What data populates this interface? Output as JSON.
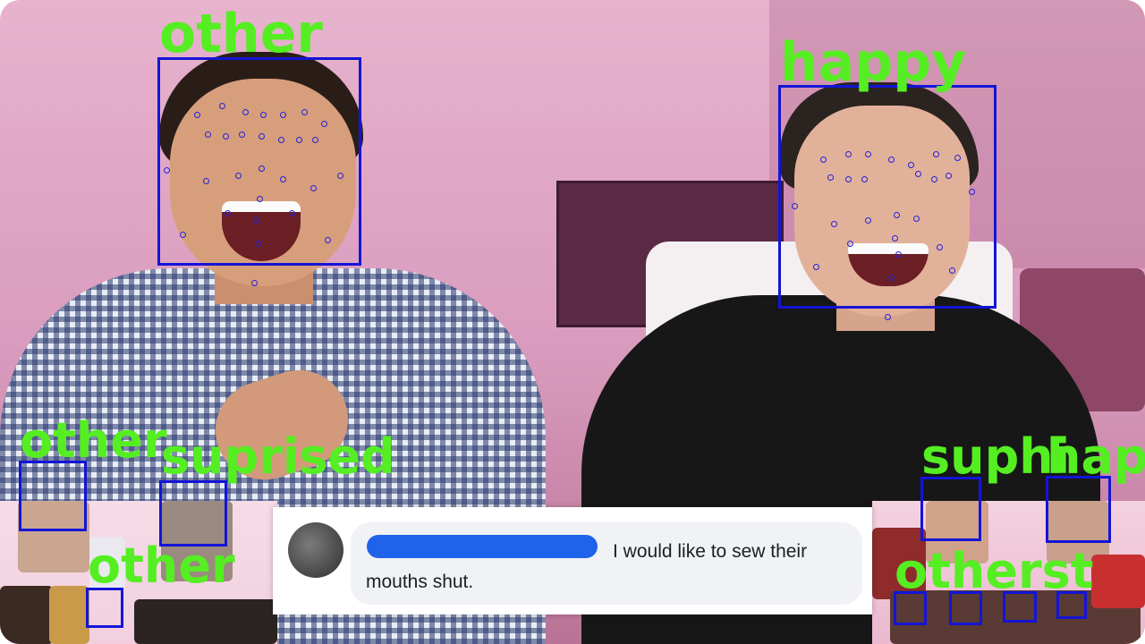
{
  "labels": {
    "big_left": "other",
    "big_right": "happy",
    "small_left_top_a": "other",
    "small_left_top_b": "suprised",
    "small_left_bottom": "other",
    "small_right_top_a": "suphi",
    "small_right_top_b": "happ",
    "small_right_bottom": "otherst"
  },
  "comment": {
    "text_line1": "I would like to sew their",
    "text_line2": "mouths shut."
  },
  "colors": {
    "label": "#55ee22",
    "box": "#1414d6",
    "redaction": "#1f63ea",
    "wall": "#e7b3cd"
  }
}
